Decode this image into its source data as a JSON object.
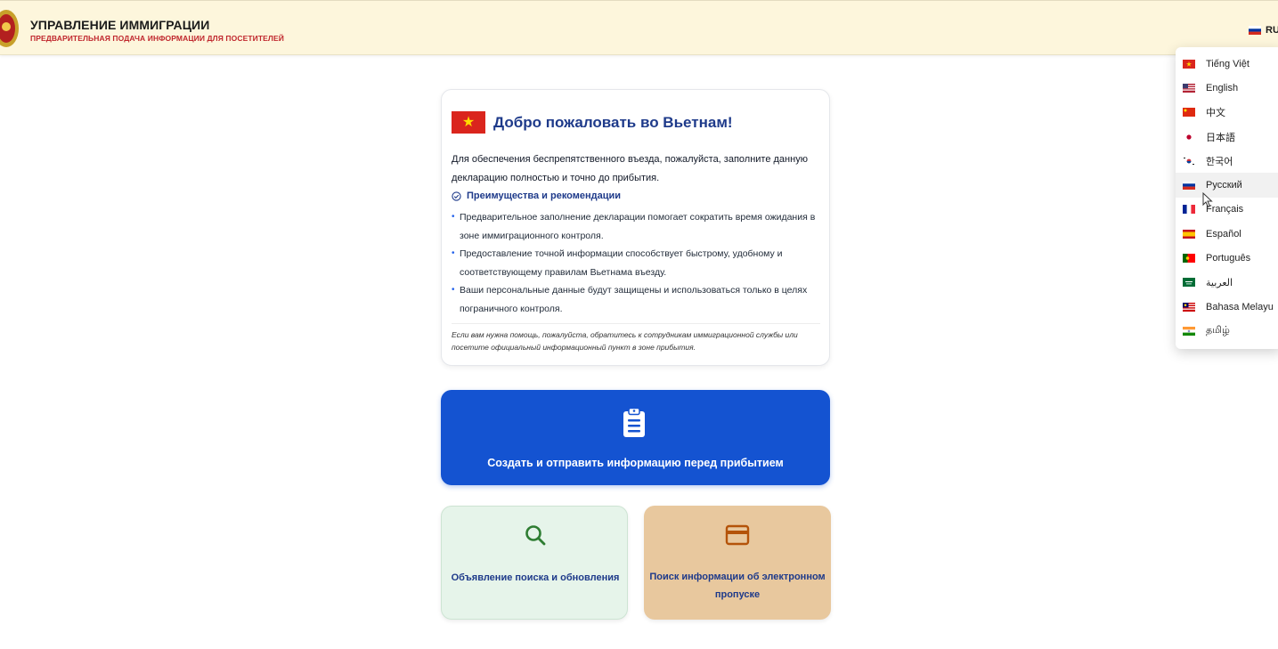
{
  "header": {
    "title": "УПРАВЛЕНИЕ ИММИГРАЦИИ",
    "subtitle": "ПРЕДВАРИТЕЛЬНАЯ ПОДАЧА ИНФОРМАЦИИ ДЛЯ ПОСЕТИТЕЛЕЙ",
    "current_language_code": "RU"
  },
  "language_menu": {
    "items": [
      {
        "label": "Tiếng Việt",
        "flag": "vietnam-flag-icon"
      },
      {
        "label": "English",
        "flag": "usa-flag-icon"
      },
      {
        "label": "中文",
        "flag": "china-flag-icon"
      },
      {
        "label": "日本語",
        "flag": "japan-flag-icon"
      },
      {
        "label": "한국어",
        "flag": "korea-flag-icon"
      },
      {
        "label": "Русский",
        "flag": "russia-flag-icon"
      },
      {
        "label": "Français",
        "flag": "france-flag-icon"
      },
      {
        "label": "Español",
        "flag": "spain-flag-icon"
      },
      {
        "label": "Português",
        "flag": "portugal-flag-icon"
      },
      {
        "label": "العربية",
        "flag": "saudi-flag-icon"
      },
      {
        "label": "Bahasa Melayu",
        "flag": "malaysia-flag-icon"
      },
      {
        "label": "தமிழ்",
        "flag": "india-flag-icon"
      }
    ],
    "hovered_index": 5
  },
  "welcome": {
    "title": "Добро пожаловать во Вьетнам!",
    "intro": "Для обеспечения беспрепятственного въезда, пожалуйста, заполните данную декларацию полностью и точно до прибытия.",
    "benefits_heading": "Преимущества и рекомендации",
    "benefits": [
      "Предварительное заполнение декларации помогает сократить время ожидания в зоне иммиграционного контроля.",
      "Предоставление точной информации способствует быстрому, удобному и соответствующему правилам Вьетнама въезду.",
      "Ваши персональные данные будут защищены и использоваться только в целях пограничного контроля."
    ],
    "note": "Если вам нужна помощь, пожалуйста, обратитесь к сотрудникам иммиграционной службы или посетите официальный информационный пункт в зоне прибытия."
  },
  "actions": {
    "create_label": "Создать и отправить информацию перед прибытием",
    "search_label": "Объявление поиска и обновления",
    "epass_label": "Поиск информации об электронном пропуске"
  },
  "colors": {
    "header_bg": "#fdf6dc",
    "primary_blue": "#1453d1",
    "title_navy": "#1e3a8a",
    "subtitle_red": "#c0272d",
    "search_tile_bg": "#e6f4ea",
    "epass_tile_bg": "#e8c89e"
  }
}
